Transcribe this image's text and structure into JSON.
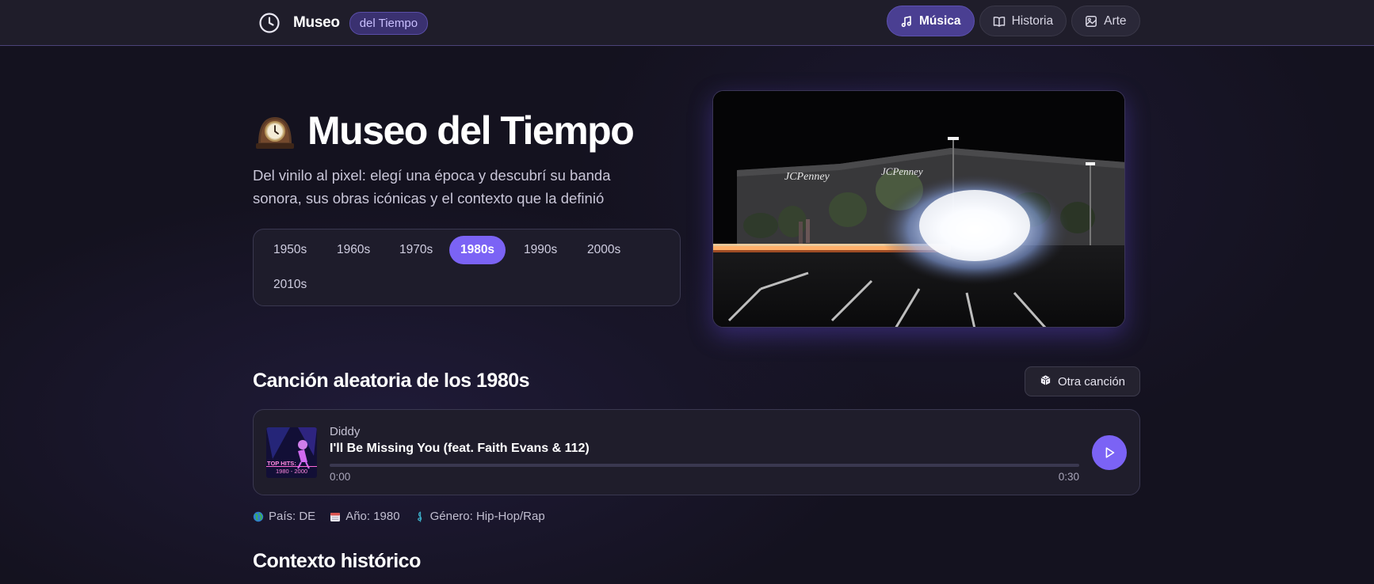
{
  "nav": {
    "brand_name": "Museo",
    "brand_tag": "del Tiempo",
    "links": [
      {
        "label": "Música",
        "icon": "music-note-icon",
        "active": true
      },
      {
        "label": "Historia",
        "icon": "book-icon",
        "active": false
      },
      {
        "label": "Arte",
        "icon": "image-icon",
        "active": false
      }
    ]
  },
  "hero": {
    "title": "Museo del Tiempo",
    "title_icon": "mantelpiece-clock-icon",
    "subtitle": "Del vinilo al pixel: elegí una época y descubrí su banda sonora, sus obras icónicas y el contexto que la definió"
  },
  "decades": {
    "items": [
      "1950s",
      "1960s",
      "1970s",
      "1980s",
      "1990s",
      "2000s",
      "2010s"
    ],
    "selected": "1980s"
  },
  "video": {
    "signs": [
      "JCPenney",
      "JCPenney"
    ]
  },
  "song_section": {
    "title": "Canción aleatoria de los 1980s",
    "other_button": "Otra canción",
    "other_button_icon": "dice-icon"
  },
  "player": {
    "artist": "Diddy",
    "title": "I'll Be Missing You (feat. Faith Evans & 112)",
    "time_current": "0:00",
    "time_total": "0:30",
    "progress": 0,
    "cover_text_line1": "TOP HITS:",
    "cover_text_line2": "1980 - 2000",
    "play_icon": "play-icon"
  },
  "meta": {
    "country": "País: DE",
    "year": "Año: 1980",
    "genre": "Género: Hip-Hop/Rap"
  },
  "context_section": {
    "title": "Contexto histórico"
  },
  "colors": {
    "accent": "#7b63f5",
    "background": "#14121f",
    "nav_active": "#4a3f92"
  }
}
